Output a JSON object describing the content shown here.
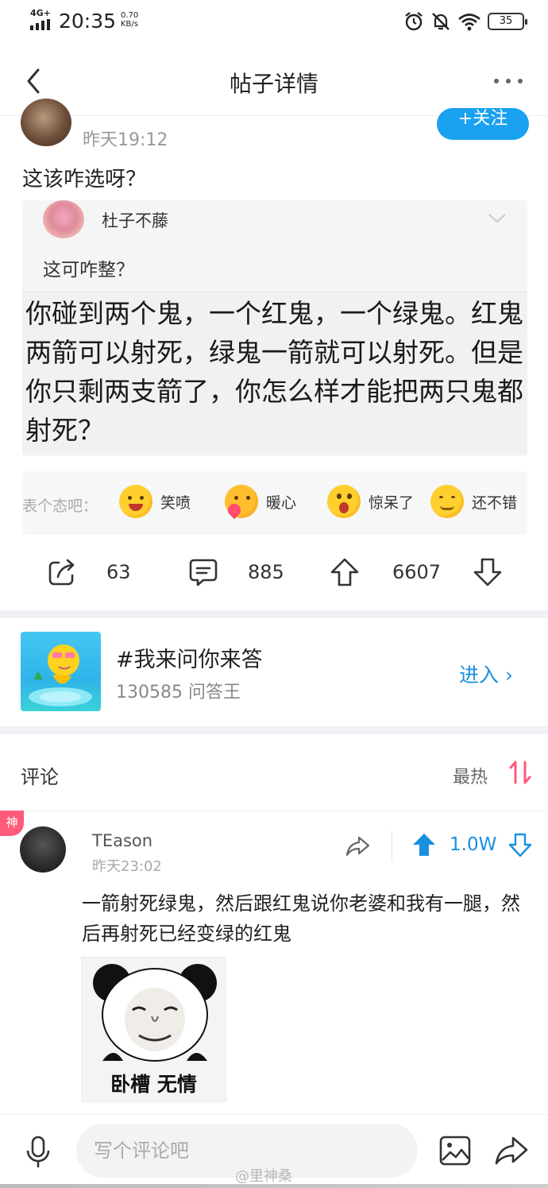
{
  "status_bar": {
    "network": "4G+",
    "time": "20:35",
    "speed_value": "0.70",
    "speed_unit": "KB/s",
    "battery": "35"
  },
  "nav": {
    "title": "帖子详情"
  },
  "post": {
    "time": "昨天19:12",
    "follow_label": "+关注",
    "text": "这该咋选呀？",
    "quoted": {
      "username": "杜子不藤",
      "text": "这可咋整？",
      "inner_text": "你碰到两个鬼，一个红鬼，一个绿鬼。红鬼两箭可以射死，绿鬼一箭就可以射死。但是你只剩两支箭了，你怎么样才能把两只鬼都射死？"
    },
    "reactions": {
      "prompt": "表个态吧：",
      "items": [
        {
          "label": "笑喷",
          "icon": "laughing-emoji-icon"
        },
        {
          "label": "暖心",
          "icon": "heart-hug-emoji-icon"
        },
        {
          "label": "惊呆了",
          "icon": "shocked-emoji-icon"
        },
        {
          "label": "还不错",
          "icon": "content-emoji-icon"
        }
      ]
    },
    "actions": {
      "shares": "63",
      "comments": "885",
      "upvotes": "6607"
    }
  },
  "topic": {
    "title": "#我来问你来答",
    "subtitle": "130585 问答王",
    "enter_label": "进入 ›"
  },
  "comments": {
    "title": "评论",
    "sort_label": "最热",
    "items": [
      {
        "badge": "神",
        "username": "TEason",
        "time": "昨天23:02",
        "likes": "1.0W",
        "text": "一箭射死绿鬼，然后跟红鬼说你老婆和我有一腿，然后再射死已经变绿的红鬼",
        "image_caption": "卧槽 无情"
      }
    ]
  },
  "bottom_bar": {
    "input_placeholder": "写个评论吧",
    "watermark": "@里神桑"
  },
  "colors": {
    "accent_blue": "#1aa1f0",
    "link_blue": "#1a8fe0",
    "badge_pink": "#ff5a7a",
    "sort_pink": "#ff5a7a"
  }
}
